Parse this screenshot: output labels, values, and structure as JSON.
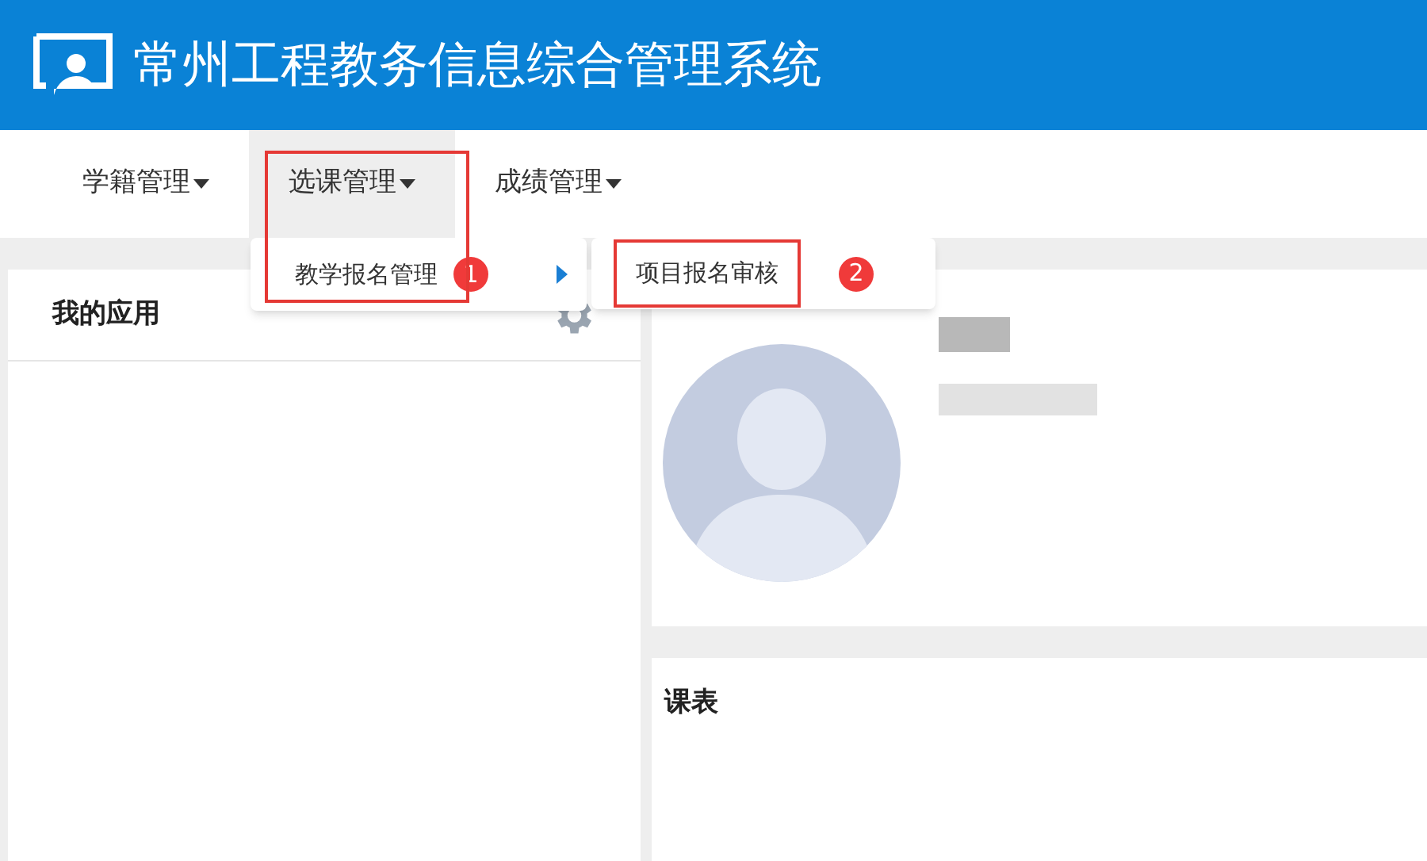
{
  "header": {
    "title": "常州工程教务信息综合管理系统"
  },
  "nav": [
    {
      "label": "学籍管理",
      "selected": false
    },
    {
      "label": "选课管理",
      "selected": true
    },
    {
      "label": "成绩管理",
      "selected": false
    }
  ],
  "dropdown": {
    "item": "教学报名管理",
    "badge": "1",
    "submenu": {
      "item": "项目报名审核",
      "badge": "2"
    }
  },
  "apps_card": {
    "title": "我的应用"
  },
  "schedule_card": {
    "title": "课表"
  }
}
